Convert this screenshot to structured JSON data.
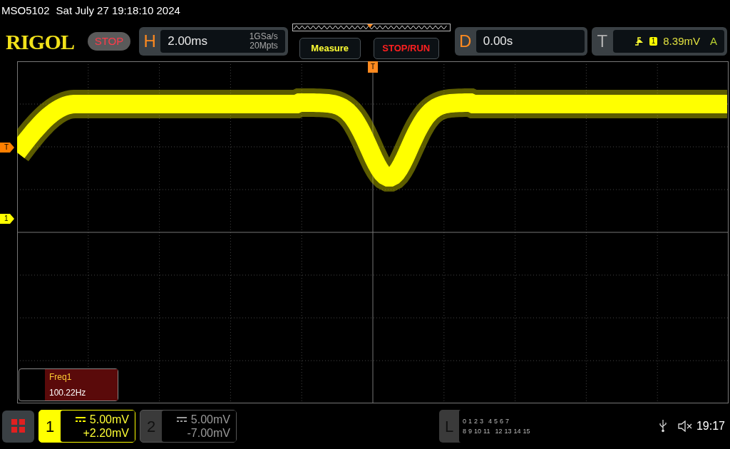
{
  "header": {
    "model": "MSO5102",
    "datetime": "Sat July 27 19:18:10 2024"
  },
  "toolbar": {
    "logo": "RIGOL",
    "run_state": {
      "label": "STOP",
      "kind": "stop"
    },
    "horizontal": {
      "letter": "H",
      "timebase": "2.00ms",
      "sample_rate": "1GSa/s",
      "memory_depth": "20Mpts"
    },
    "measure_button": "Measure",
    "stop_run_button": "STOP/RUN",
    "delay": {
      "letter": "D",
      "value": "0.00s"
    },
    "trigger": {
      "letter": "T",
      "source": "1",
      "level": "8.39mV",
      "mode": "A"
    }
  },
  "grid": {
    "trigger_marker": "T",
    "left_markers": [
      {
        "label": "T",
        "color": "#ff7f00"
      },
      {
        "label": "1",
        "color": "#ffff00"
      }
    ]
  },
  "measurements": [
    {
      "name": "Freq1",
      "value": "100.22Hz"
    }
  ],
  "channels": [
    {
      "number": "1",
      "scale": "5.00mV",
      "offset": "+2.20mV",
      "on": true
    },
    {
      "number": "2",
      "scale": "5.00mV",
      "offset": "-7.00mV",
      "on": false
    }
  ],
  "logic": {
    "letter": "L",
    "row_1": [
      "0",
      "1",
      "2",
      "3",
      "4",
      "5",
      "6",
      "7"
    ],
    "row_2": [
      "8",
      "9",
      "10",
      "11",
      "12",
      "13",
      "14",
      "15"
    ]
  },
  "status": {
    "time": "19:17",
    "muted": true
  }
}
